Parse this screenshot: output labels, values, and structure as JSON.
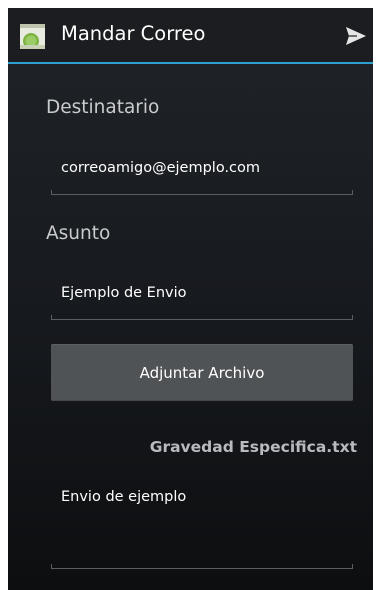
{
  "action_bar": {
    "title": "Mandar Correo",
    "app_icon": "android-app-icon",
    "send_icon": "send-icon",
    "accent_color": "#2f9fd0"
  },
  "form": {
    "to_label": "Destinatario",
    "to_value": "correoamigo@ejemplo.com",
    "subject_label": "Asunto",
    "subject_value": "Ejemplo de Envio",
    "attach_button_label": "Adjuntar Archivo",
    "attached_filename": "Gravedad Especifica.txt",
    "body_value": "Envio de ejemplo"
  }
}
